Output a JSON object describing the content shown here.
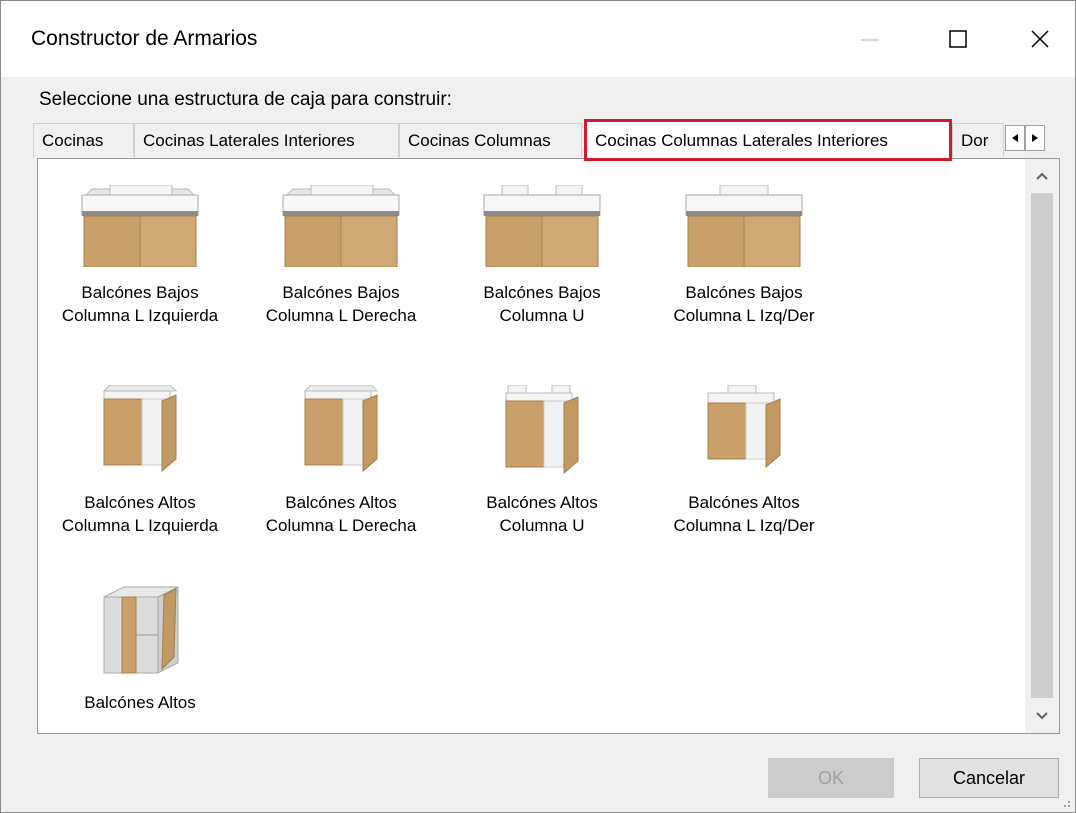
{
  "window": {
    "title": "Constructor de Armarios",
    "minimize_icon": "minimize-icon",
    "maximize_icon": "maximize-icon",
    "close_icon": "close-icon"
  },
  "instruction": "Seleccione una estructura de caja para construir:",
  "tabs": [
    {
      "label": "Cocinas",
      "active": false
    },
    {
      "label": "Cocinas Laterales Interiores",
      "active": false
    },
    {
      "label": "Cocinas Columnas",
      "active": false
    },
    {
      "label": "Cocinas Columnas Laterales Interiores",
      "active": true
    },
    {
      "label": "Dor",
      "active": false
    }
  ],
  "tab_scroll": {
    "left_icon": "triangle-left-icon",
    "right_icon": "triangle-right-icon"
  },
  "items": [
    {
      "line1": "Balcónes Bajos",
      "line2": "Columna L Izquierda",
      "icon": "base-cabinet-icon"
    },
    {
      "line1": "Balcónes Bajos",
      "line2": "Columna L Derecha",
      "icon": "base-cabinet-icon"
    },
    {
      "line1": "Balcónes Bajos",
      "line2": "Columna U",
      "icon": "base-cabinet-icon"
    },
    {
      "line1": "Balcónes Bajos",
      "line2": "Columna L Izq/Der",
      "icon": "base-cabinet-icon"
    },
    {
      "line1": "Balcónes Altos",
      "line2": "Columna L Izquierda",
      "icon": "wall-cabinet-icon"
    },
    {
      "line1": "Balcónes Altos",
      "line2": "Columna L Derecha",
      "icon": "wall-cabinet-icon"
    },
    {
      "line1": "Balcónes Altos",
      "line2": "Columna U",
      "icon": "wall-cabinet-icon"
    },
    {
      "line1": "Balcónes Altos",
      "line2": "Columna L Izq/Der",
      "icon": "wall-cabinet-icon"
    },
    {
      "line1": "Balcónes Altos",
      "line2": "",
      "icon": "wall-cabinet-open-icon"
    }
  ],
  "buttons": {
    "ok": "OK",
    "cancel": "Cancelar"
  },
  "colors": {
    "accent_highlight": "#d11a2a",
    "wood": "#c9a06a",
    "wood_dark": "#a87f4b"
  }
}
